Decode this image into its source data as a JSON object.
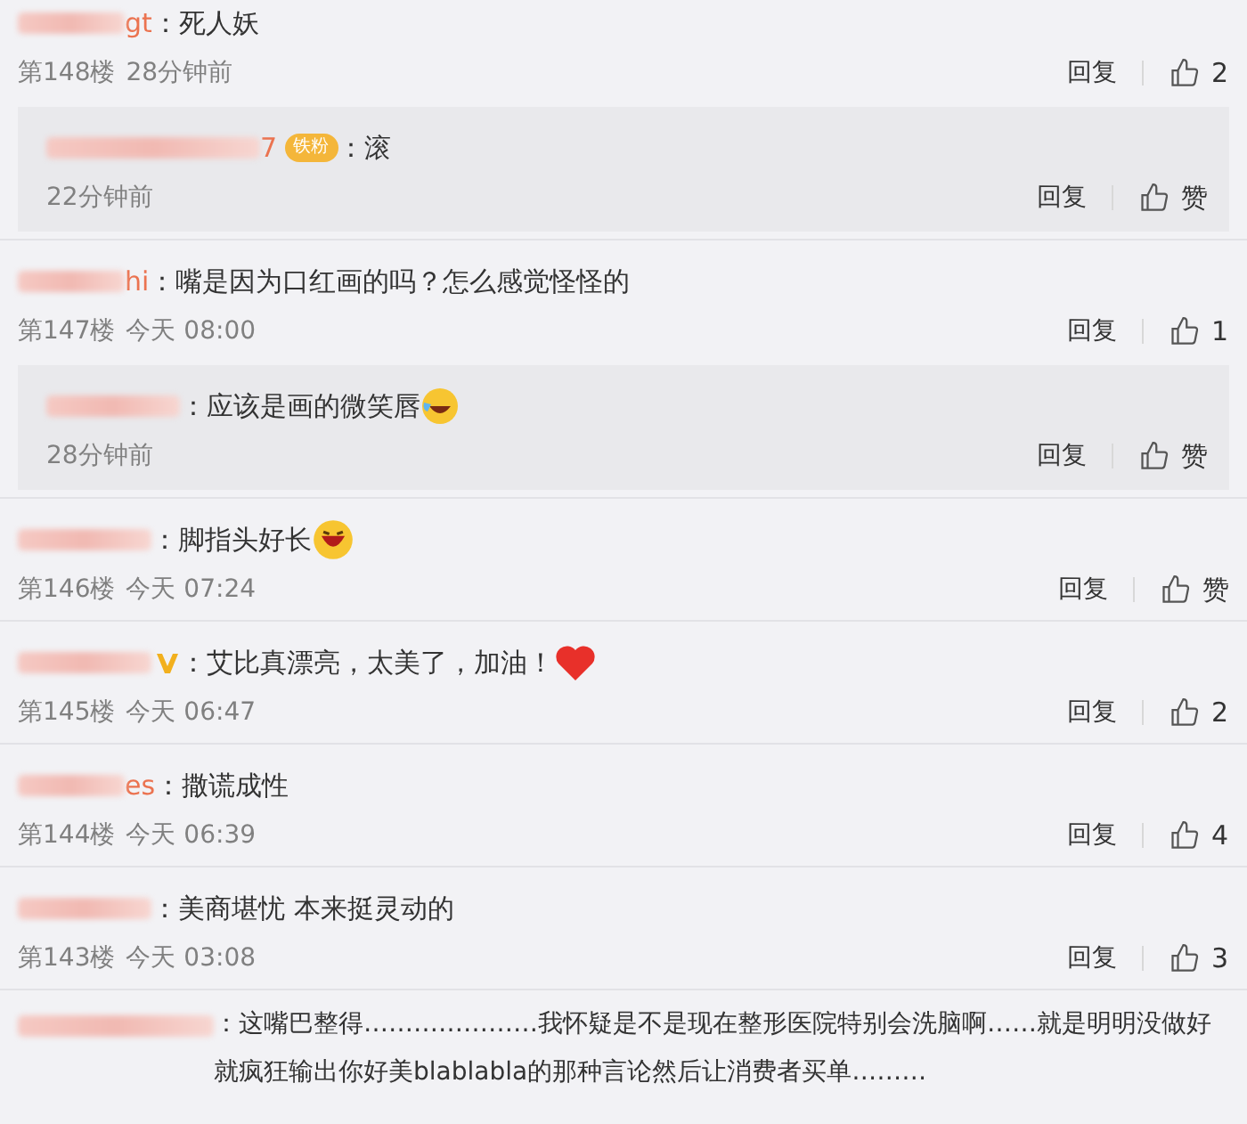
{
  "comments": [
    {
      "name_suffix": "gt",
      "text": "：死人妖",
      "floor": "第148楼",
      "time": "28分钟前",
      "reply": "回复",
      "likes": "2",
      "replies": [
        {
          "name_suffix": "7",
          "badge": {
            "kind": "fan",
            "label": "铁粉"
          },
          "text": "：滚",
          "time": "22分钟前",
          "reply": "回复",
          "likes": "赞"
        }
      ]
    },
    {
      "name_suffix": "hi",
      "text": "：嘴是因为口红画的吗？怎么感觉怪怪的",
      "floor": "第147楼",
      "time": "今天 08:00",
      "reply": "回复",
      "likes": "1",
      "replies": [
        {
          "text": "：应该是画的微笑唇",
          "emoji": {
            "kind": "laugh-cry"
          },
          "time": "28分钟前",
          "reply": "回复",
          "likes": "赞"
        }
      ]
    },
    {
      "text": "：脚指头好长",
      "emoji": {
        "kind": "laugh"
      },
      "floor": "第146楼",
      "time": "今天 07:24",
      "reply": "回复",
      "likes": "赞"
    },
    {
      "badge": {
        "kind": "verified"
      },
      "text": "：艾比真漂亮，太美了，加油！",
      "emoji": {
        "kind": "heart"
      },
      "floor": "第145楼",
      "time": "今天 06:47",
      "reply": "回复",
      "likes": "2"
    },
    {
      "name_suffix": "es",
      "text": "：撒谎成性",
      "floor": "第144楼",
      "time": "今天 06:39",
      "reply": "回复",
      "likes": "4"
    },
    {
      "text": "：美商堪忧 本来挺灵动的",
      "floor": "第143楼",
      "time": "今天 03:08",
      "reply": "回复",
      "likes": "3"
    },
    {
      "text": "：这嘴巴整得…………………我怀疑是不是现在整形医院特别会洗脑啊……就是明明没做好就疯狂输出你好美blablabla的那种言论然后让消费者买单………"
    }
  ]
}
